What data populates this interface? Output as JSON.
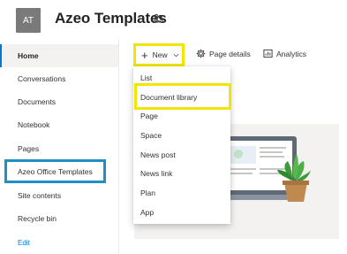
{
  "site": {
    "logo_initials": "AT",
    "title": "Azeo Templates"
  },
  "nav": {
    "items": [
      {
        "label": "Home"
      },
      {
        "label": "Conversations"
      },
      {
        "label": "Documents"
      },
      {
        "label": "Notebook"
      },
      {
        "label": "Pages"
      },
      {
        "label": "Azeo Office Templates"
      },
      {
        "label": "Site contents"
      },
      {
        "label": "Recycle bin"
      }
    ],
    "edit_label": "Edit"
  },
  "toolbar": {
    "new_label": "New",
    "page_details_label": "Page details",
    "analytics_label": "Analytics"
  },
  "new_menu": {
    "items": [
      {
        "label": "List"
      },
      {
        "label": "Document library"
      },
      {
        "label": "Page"
      },
      {
        "label": "Space"
      },
      {
        "label": "News post"
      },
      {
        "label": "News link"
      },
      {
        "label": "Plan"
      },
      {
        "label": "App"
      }
    ]
  },
  "colors": {
    "highlight_yellow": "#f2e600",
    "highlight_teal": "#1f8fc4",
    "accent_blue": "#0078d4",
    "plant_green": "#3f9a3a",
    "pot_brown": "#c0894f"
  },
  "icons": {
    "site_meta": "people-group-icon",
    "new": "plus-icon",
    "new_chevron": "chevron-down-icon",
    "page_details": "gear-icon",
    "analytics": "analytics-chart-icon"
  }
}
